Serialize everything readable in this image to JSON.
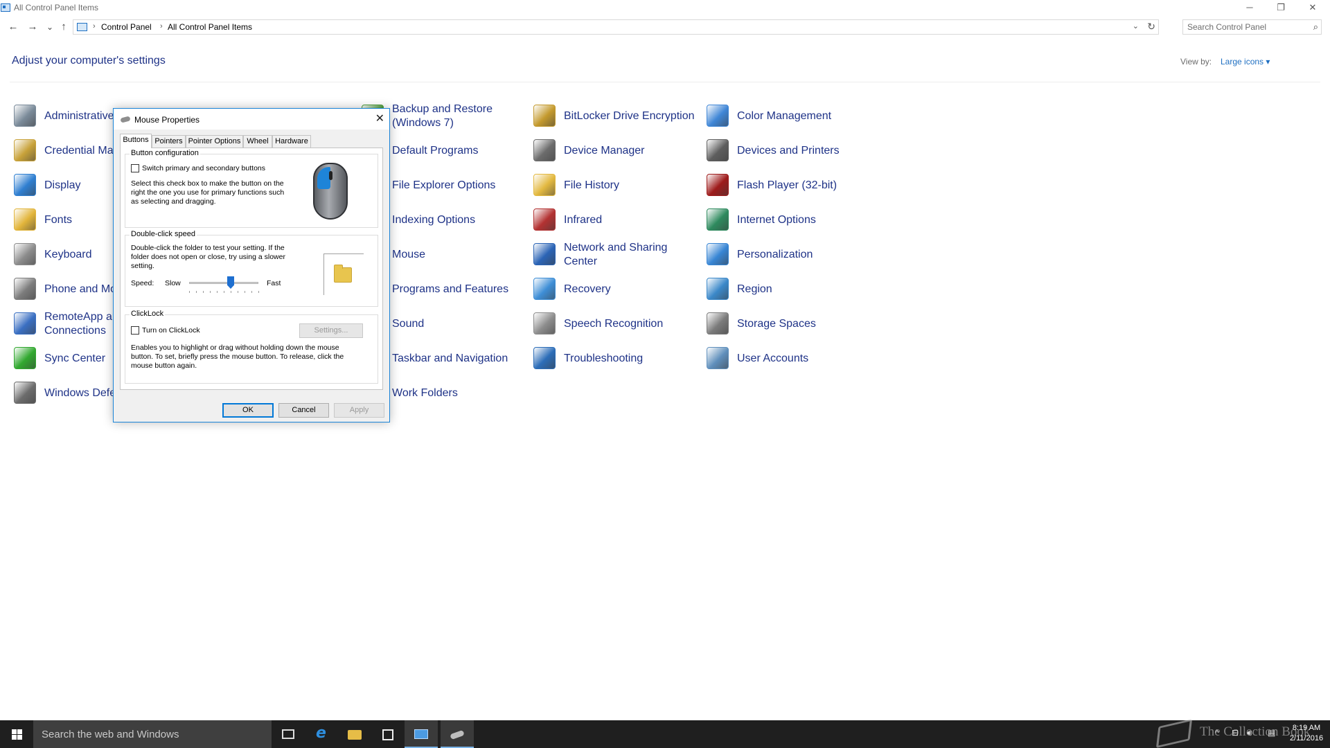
{
  "window": {
    "title": "All Control Panel Items",
    "minimize": "─",
    "restore": "❐",
    "close": "✕"
  },
  "address": {
    "back": "←",
    "forward": "→",
    "recent": "⌄",
    "up": "↑",
    "separator": "›",
    "crumbs": [
      "Control Panel",
      "All Control Panel Items"
    ],
    "dropdown": "⌄",
    "refresh": "↻"
  },
  "search": {
    "placeholder": "Search Control Panel",
    "icon": "⌕"
  },
  "header": {
    "title": "Adjust your computer's settings",
    "view_by_label": "View by:",
    "view_by_value": "Large icons"
  },
  "items": {
    "col1": [
      {
        "label": "Administrative Tools",
        "icon": "admin-tools-icon",
        "color": "#7a8a99"
      },
      {
        "label": "Credential Manager",
        "icon": "credential-icon",
        "color": "#c8a23a"
      },
      {
        "label": "Display",
        "icon": "display-icon",
        "color": "#2f7fd1"
      },
      {
        "label": "Fonts",
        "icon": "fonts-icon",
        "color": "#e2b53b"
      },
      {
        "label": "Keyboard",
        "icon": "keyboard-icon",
        "color": "#8c8c8c"
      },
      {
        "label": "Phone and Modem",
        "icon": "phone-icon",
        "color": "#7c7c7c"
      },
      {
        "label": "RemoteApp and Desktop\nConnections",
        "icon": "remoteapp-icon",
        "color": "#3a6fc2"
      },
      {
        "label": "Sync Center",
        "icon": "sync-icon",
        "color": "#31a82f"
      },
      {
        "label": "Windows Defender",
        "icon": "defender-icon",
        "color": "#6c6c6c"
      }
    ],
    "col2": [
      {
        "label": "Backup and Restore\n(Windows 7)",
        "icon": "backup-icon",
        "color": "#4d9d3a"
      },
      {
        "label": "Default Programs",
        "icon": "default-programs-icon",
        "color": "#2d7fd2"
      },
      {
        "label": "File Explorer Options",
        "icon": "folder-options-icon",
        "color": "#e5bf48"
      },
      {
        "label": "Indexing Options",
        "icon": "indexing-icon",
        "color": "#7c7c7c"
      },
      {
        "label": "Mouse",
        "icon": "mouse-icon",
        "color": "#5f5f5f"
      },
      {
        "label": "Programs and Features",
        "icon": "programs-icon",
        "color": "#5f7fa8"
      },
      {
        "label": "Sound",
        "icon": "sound-icon",
        "color": "#8c8c8c"
      },
      {
        "label": "Taskbar and Navigation",
        "icon": "taskbar-icon",
        "color": "#3c6eb4"
      },
      {
        "label": "Work Folders",
        "icon": "work-folders-icon",
        "color": "#3c84d0"
      }
    ],
    "col3": [
      {
        "label": "BitLocker Drive Encryption",
        "icon": "bitlocker-icon",
        "color": "#c49a2e"
      },
      {
        "label": "Device Manager",
        "icon": "device-manager-icon",
        "color": "#6c6c6c"
      },
      {
        "label": "File History",
        "icon": "file-history-icon",
        "color": "#e3b940"
      },
      {
        "label": "Infrared",
        "icon": "infrared-icon",
        "color": "#b33232"
      },
      {
        "label": "Network and Sharing\nCenter",
        "icon": "network-icon",
        "color": "#2b64b6"
      },
      {
        "label": "Recovery",
        "icon": "recovery-icon",
        "color": "#3e8ed6"
      },
      {
        "label": "Speech Recognition",
        "icon": "microphone-icon",
        "color": "#8d8d8d"
      },
      {
        "label": "Troubleshooting",
        "icon": "troubleshooting-icon",
        "color": "#2c6db8"
      }
    ],
    "col4": [
      {
        "label": "Color Management",
        "icon": "color-management-icon",
        "color": "#3f86d6"
      },
      {
        "label": "Devices and Printers",
        "icon": "printer-icon",
        "color": "#5e5e5e"
      },
      {
        "label": "Flash Player (32-bit)",
        "icon": "flash-icon",
        "color": "#9e1b1b"
      },
      {
        "label": "Internet Options",
        "icon": "internet-options-icon",
        "color": "#2e8a5e"
      },
      {
        "label": "Personalization",
        "icon": "personalization-icon",
        "color": "#3785d4"
      },
      {
        "label": "Region",
        "icon": "region-icon",
        "color": "#3b88c9"
      },
      {
        "label": "Storage Spaces",
        "icon": "storage-icon",
        "color": "#7b7b7b"
      },
      {
        "label": "User Accounts",
        "icon": "user-accounts-icon",
        "color": "#5f8fbc"
      }
    ]
  },
  "dialog": {
    "title": "Mouse Properties",
    "close": "✕",
    "tabs": [
      "Buttons",
      "Pointers",
      "Pointer Options",
      "Wheel",
      "Hardware"
    ],
    "active_tab": "Buttons",
    "button_config": {
      "title": "Button configuration",
      "checkbox_label": "Switch primary and secondary buttons",
      "description": "Select this check box to make the button on the right the one you use for primary functions such as selecting and dragging."
    },
    "double_click": {
      "title": "Double-click speed",
      "description": "Double-click the folder to test your setting. If the folder does not open or close, try using a slower setting.",
      "speed_label": "Speed:",
      "slow": "Slow",
      "fast": "Fast",
      "speed_fraction": 0.6
    },
    "clicklock": {
      "title": "ClickLock",
      "checkbox_label": "Turn on ClickLock",
      "settings_button": "Settings...",
      "description": "Enables you to highlight or drag without holding down the mouse button. To set, briefly press the mouse button. To release, click the mouse button again."
    },
    "ok": "OK",
    "cancel": "Cancel",
    "apply": "Apply"
  },
  "taskbar": {
    "search_placeholder": "Search the web and Windows",
    "clock_time": "8:19 AM",
    "clock_date": "2/11/2016",
    "tray_up": "^",
    "tray_network": "⊟",
    "tray_volume": "🔊︎",
    "tray_action": "▤"
  },
  "watermark": {
    "text": "The Collection Book"
  }
}
